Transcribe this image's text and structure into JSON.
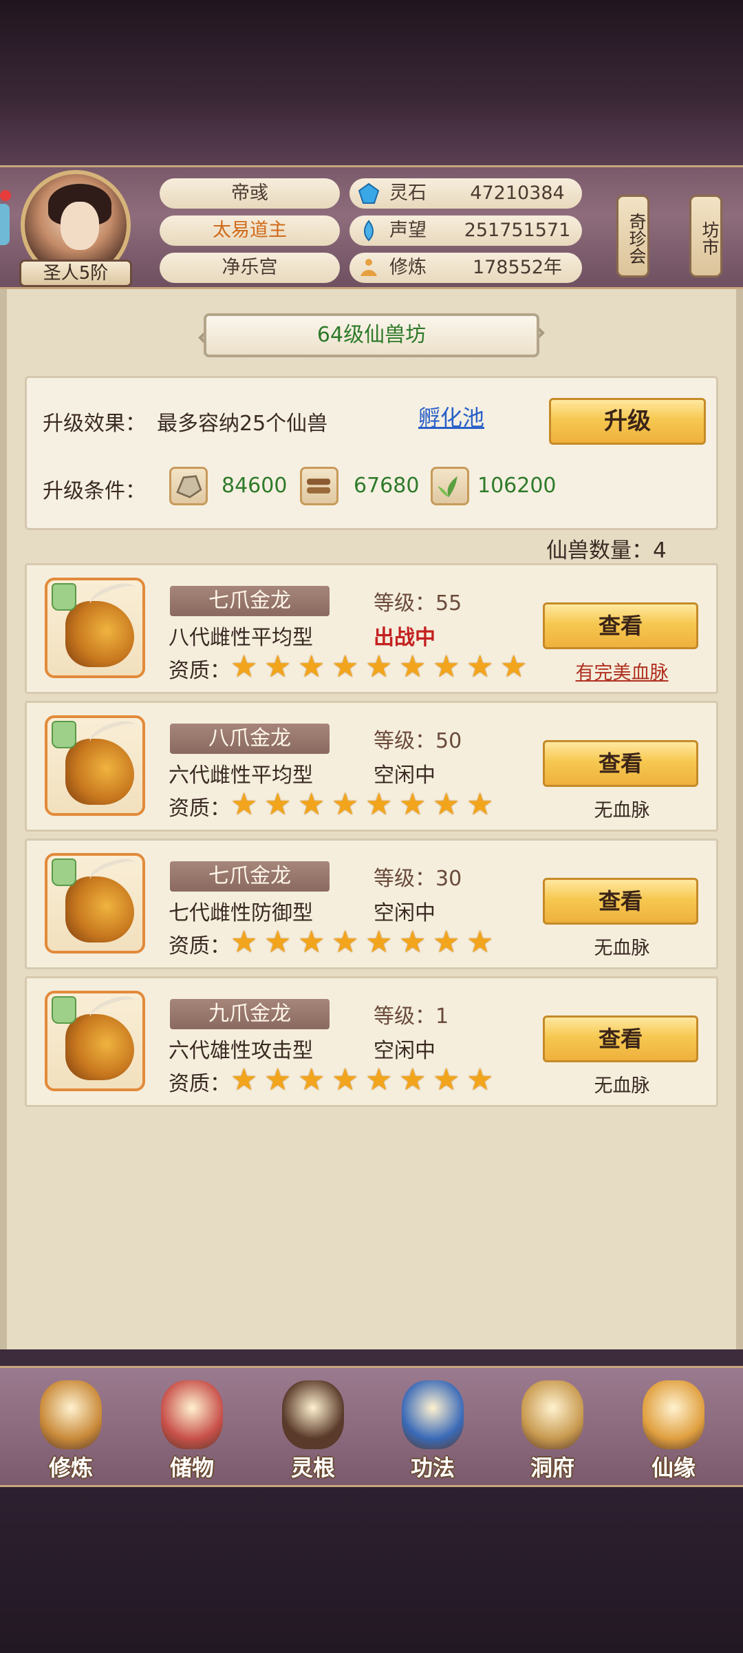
{
  "player": {
    "rank": "圣人5阶",
    "name_lines": [
      "帝彧",
      "太易道主",
      "净乐宫"
    ]
  },
  "resources": [
    {
      "label": "灵石",
      "value": "47210384",
      "icon": "spirit-stone-icon"
    },
    {
      "label": "声望",
      "value": "251751571",
      "icon": "reputation-icon"
    },
    {
      "label": "修炼",
      "value": "178552年",
      "icon": "cultivation-icon"
    }
  ],
  "side_buttons": {
    "treasure": "奇珍会",
    "market": "坊市"
  },
  "workshop": {
    "title": "64级仙兽坊",
    "effect_label": "升级效果：",
    "effect_text": "最多容纳25个仙兽",
    "hatch_link": "孵化池",
    "upgrade_button": "升级",
    "condition_label": "升级条件：",
    "materials": [
      {
        "icon": "ore-icon",
        "value": "84600"
      },
      {
        "icon": "wood-icon",
        "value": "67680"
      },
      {
        "icon": "herb-icon",
        "value": "106200"
      }
    ],
    "count_label": "仙兽数量：4"
  },
  "pets": [
    {
      "name": "七爪金龙",
      "level": "等级：55",
      "type": "八代雌性平均型",
      "status": "出战中",
      "quality_label": "资质：",
      "stars": 9,
      "button": "查看",
      "bloodline": "有完美血脉"
    },
    {
      "name": "八爪金龙",
      "level": "等级：50",
      "type": "六代雌性平均型",
      "status": "空闲中",
      "quality_label": "资质：",
      "stars": 8,
      "button": "查看",
      "bloodline": "无血脉"
    },
    {
      "name": "七爪金龙",
      "level": "等级：30",
      "type": "七代雌性防御型",
      "status": "空闲中",
      "quality_label": "资质：",
      "stars": 8,
      "button": "查看",
      "bloodline": "无血脉"
    },
    {
      "name": "九爪金龙",
      "level": "等级：1",
      "type": "六代雄性攻击型",
      "status": "空闲中",
      "quality_label": "资质：",
      "stars": 8,
      "button": "查看",
      "bloodline": "无血脉"
    }
  ],
  "nav": [
    {
      "label": "修炼",
      "icon": "monk-icon",
      "color": "#c98a3a"
    },
    {
      "label": "储物",
      "icon": "bag-icon",
      "color": "#c8504a"
    },
    {
      "label": "灵根",
      "icon": "spirit-root-icon",
      "color": "#5a3a2a"
    },
    {
      "label": "功法",
      "icon": "book-icon",
      "color": "#3a6ab8"
    },
    {
      "label": "洞府",
      "icon": "palace-icon",
      "color": "#c89a50"
    },
    {
      "label": "仙缘",
      "icon": "gourd-icon",
      "color": "#e0a040"
    }
  ],
  "colors": {
    "accent_green": "#2e7a2a",
    "battle_red": "#c42020",
    "link_blue": "#2a60c8",
    "gold_button": "#f6c851"
  }
}
